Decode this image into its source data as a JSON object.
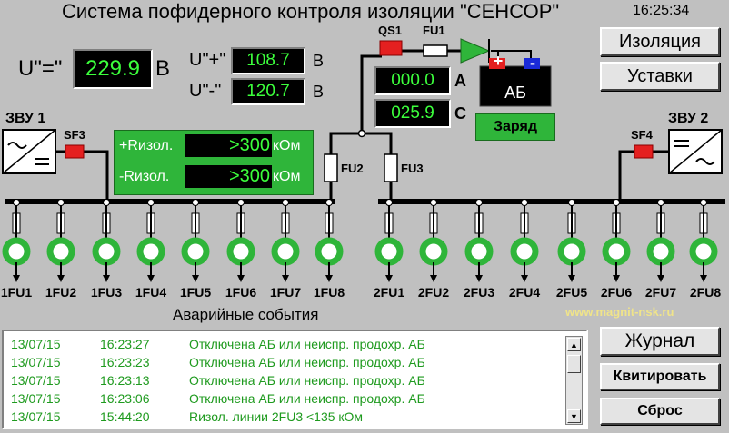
{
  "header": {
    "title": "Система пофидерного контроля изоляции \"СЕНСОР\"",
    "clock": "16:25:34"
  },
  "voltage": {
    "total_label": "U\"=\"",
    "total_value": "229.9",
    "total_unit": "В",
    "plus_label": "U\"+\"",
    "plus_value": "108.7",
    "plus_unit": "В",
    "minus_label": "U\"-\"",
    "minus_value": "120.7",
    "minus_unit": "В"
  },
  "battery": {
    "current_a_value": "000.0",
    "current_a_label": "А",
    "current_c_value": "025.9",
    "current_c_label": "С",
    "ab_label": "АБ",
    "plus_sign": "+",
    "minus_sign": "-",
    "mode_label": "Заряд"
  },
  "insulation": {
    "plus_label": "+Rизол.",
    "plus_value": ">300",
    "plus_unit": "кОм",
    "minus_label": "-Rизол.",
    "minus_value": ">300",
    "minus_unit": "кОм"
  },
  "equipment": {
    "zvu1": "ЗВУ 1",
    "zvu2": "ЗВУ 2",
    "sf3": "SF3",
    "sf4": "SF4",
    "qs1": "QS1",
    "fu1": "FU1",
    "fu2": "FU2",
    "fu3": "FU3"
  },
  "feeders_bus1": [
    "1FU1",
    "1FU2",
    "1FU3",
    "1FU4",
    "1FU5",
    "1FU6",
    "1FU7",
    "1FU8"
  ],
  "feeders_bus2": [
    "2FU1",
    "2FU2",
    "2FU3",
    "2FU4",
    "2FU5",
    "2FU6",
    "2FU7",
    "2FU8"
  ],
  "buttons": {
    "isolation": "Изоляция",
    "settings": "Уставки",
    "journal": "Журнал",
    "acknowledge": "Квитировать",
    "reset": "Сброс"
  },
  "events": {
    "title": "Аварийные события",
    "website": "www.magnit-nsk.ru",
    "rows": [
      {
        "date": "13/07/15",
        "time": "16:23:27",
        "text": "Отключена АБ или неиспр. продохр. АБ"
      },
      {
        "date": "13/07/15",
        "time": "16:23:23",
        "text": "Отключена АБ или неиспр. продохр. АБ"
      },
      {
        "date": "13/07/15",
        "time": "16:23:13",
        "text": "Отключена АБ или неиспр. продохр. АБ"
      },
      {
        "date": "13/07/15",
        "time": "16:23:06",
        "text": "Отключена АБ или неиспр. продохр. АБ"
      },
      {
        "date": "13/07/15",
        "time": "15:44:20",
        "text": "Rизол. линии 2FU3 <135 кОм"
      }
    ]
  },
  "colors": {
    "background": "#c0c0c0",
    "lcd_text": "#3cff3c",
    "breaker_red": "#e42020",
    "status_green": "#2fb53a",
    "event_text": "#1e9a1e"
  }
}
